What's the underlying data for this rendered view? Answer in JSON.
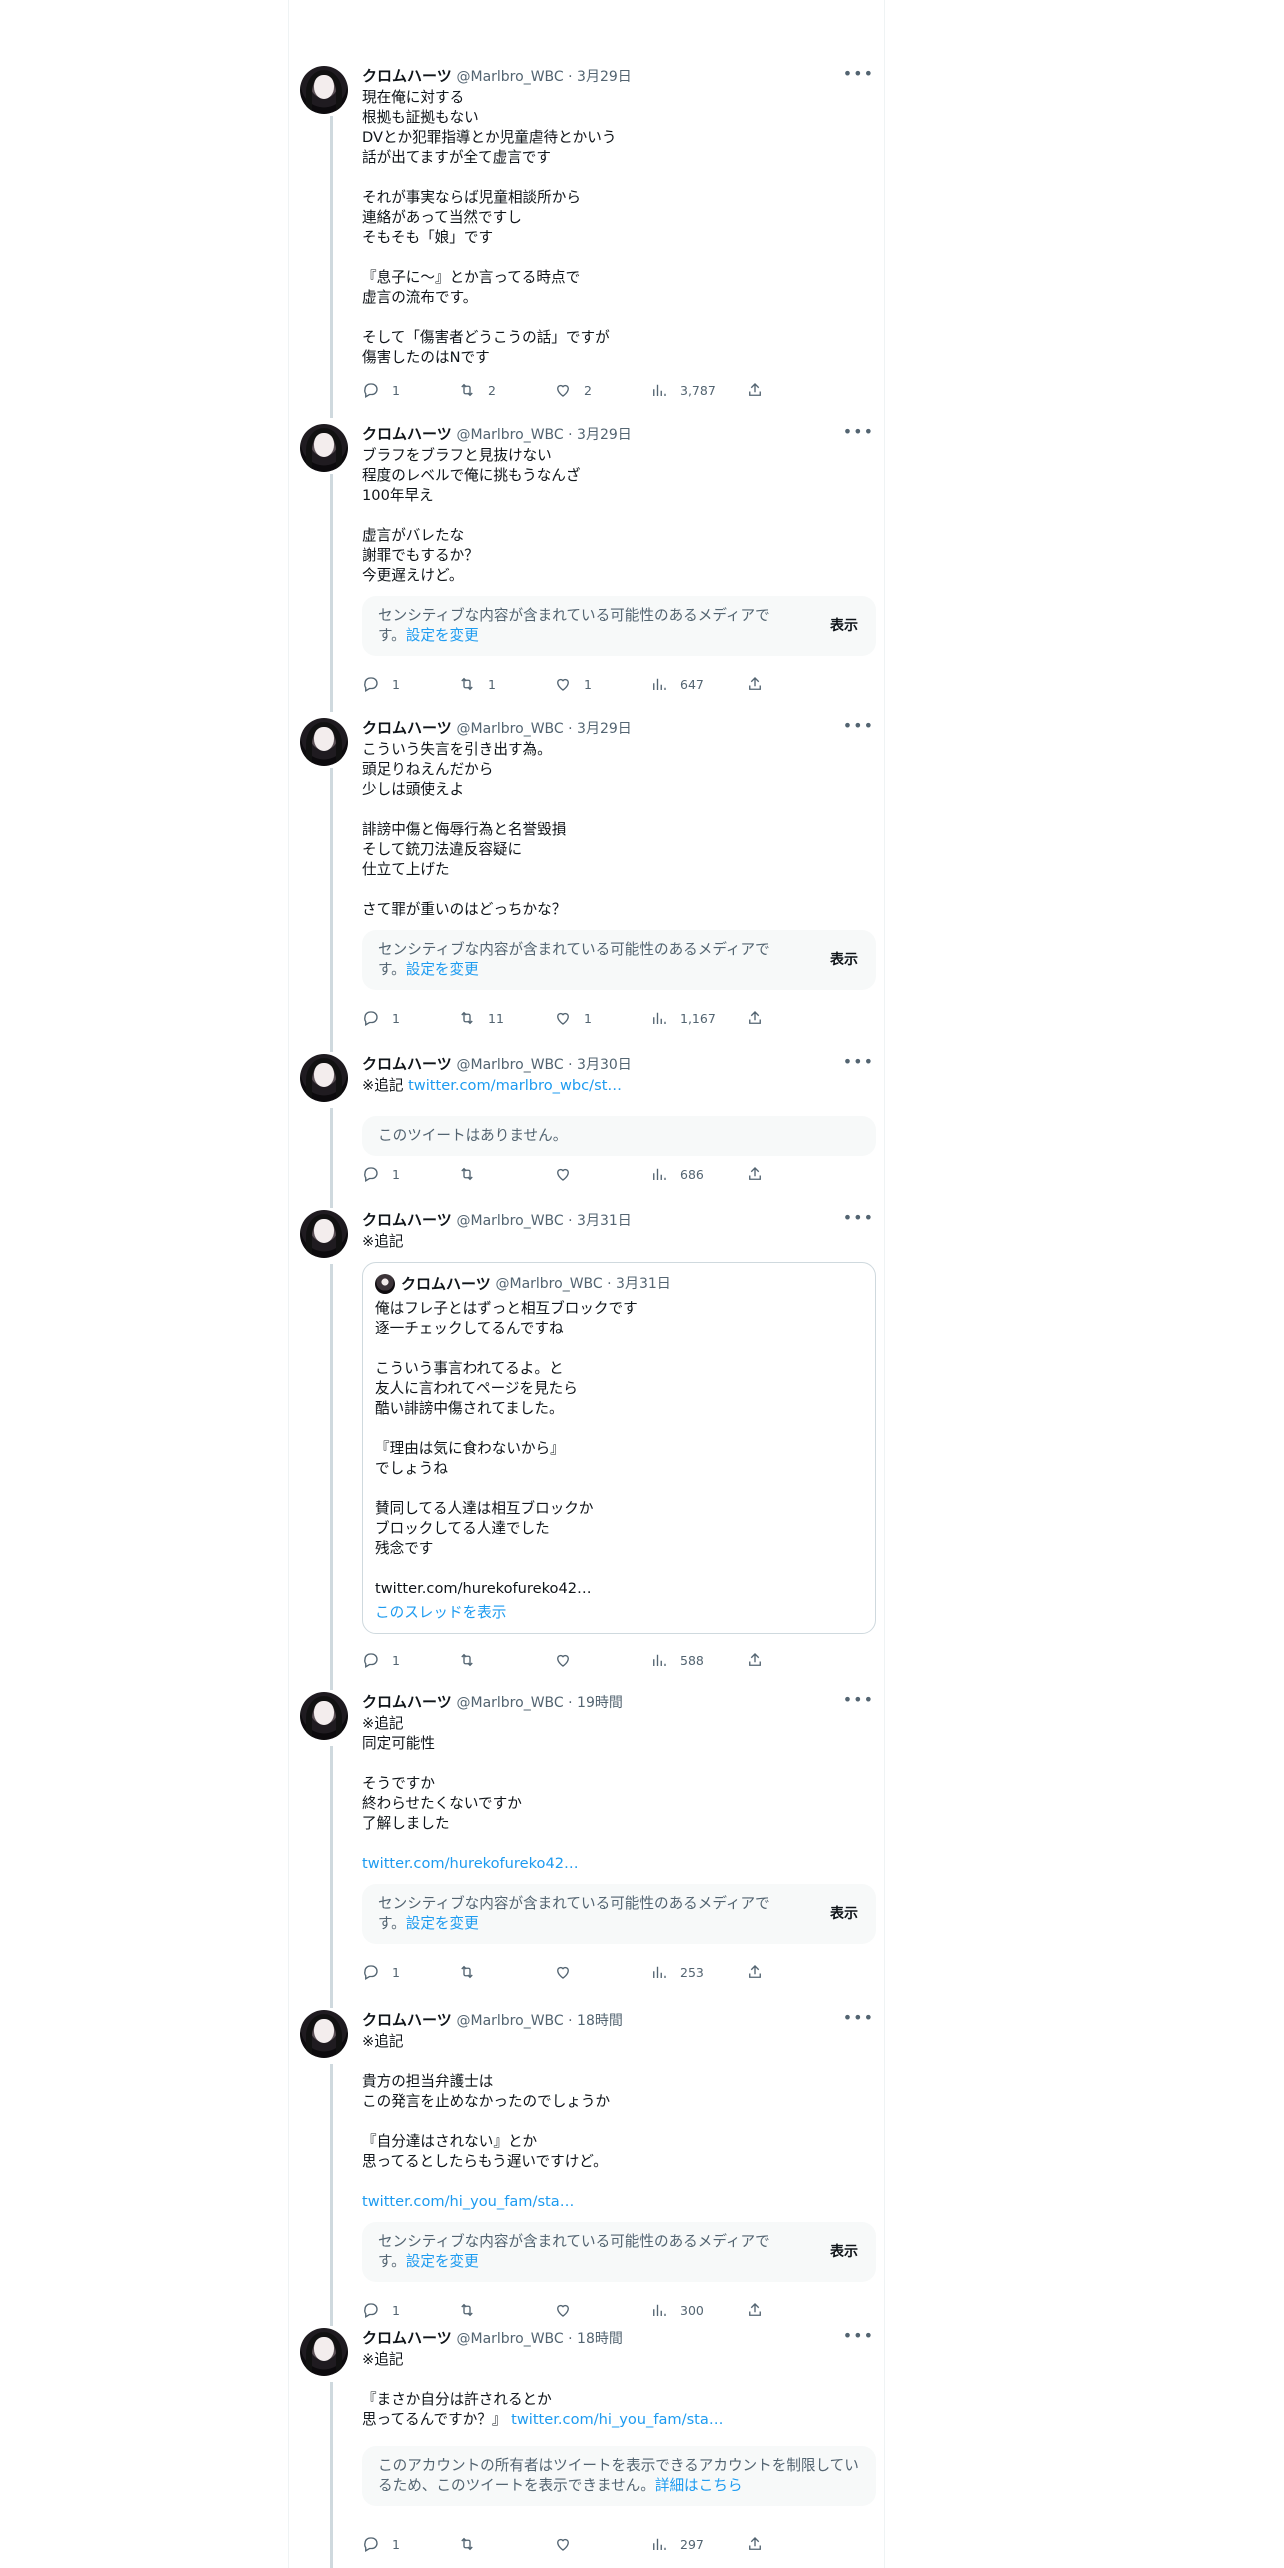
{
  "tweets": [
    {
      "name": "クロムハーツ",
      "handle": "@Marlbro_WBC",
      "time": "3月29日",
      "text": "現在俺に対する\n根拠も証拠もない\nDVとか犯罪指導とか児童虐待とかいう\n話が出てますが全て虚言です\n\nそれが事実ならば児童相談所から\n連絡があって当然ですし\nそもそも「娘」です\n\n『息子に〜』とか言ってる時点で\n虚言の流布です。\n\nそして「傷害者どうこうの話」ですが\n傷害したのはNです",
      "replies": "1",
      "retweets": "2",
      "likes": "2",
      "views": "3,787"
    },
    {
      "name": "クロムハーツ",
      "handle": "@Marlbro_WBC",
      "time": "3月29日",
      "text": "ブラフをブラフと見抜けない\n程度のレベルで俺に挑もうなんざ\n100年早え\n\n虚言がバレたな\n謝罪でもするか？\n今更遅えけど。",
      "sensitive": "センシティブな内容が含まれている可能性のあるメディアです。",
      "sensitive_link": "設定を変更",
      "show": "表示",
      "replies": "1",
      "retweets": "1",
      "likes": "1",
      "views": "647"
    },
    {
      "name": "クロムハーツ",
      "handle": "@Marlbro_WBC",
      "time": "3月29日",
      "text": "こういう失言を引き出す為。\n頭足りねえんだから\n少しは頭使えよ\n\n誹謗中傷と侮辱行為と名誉毀損\nそして銃刀法違反容疑に\n仕立て上げた\n\nさて罪が重いのはどっちかな？",
      "sensitive": "センシティブな内容が含まれている可能性のあるメディアです。",
      "sensitive_link": "設定を変更",
      "show": "表示",
      "replies": "1",
      "retweets": "11",
      "likes": "1",
      "views": "1,167"
    },
    {
      "name": "クロムハーツ",
      "handle": "@Marlbro_WBC",
      "time": "3月30日",
      "text_prefix": "※追記 ",
      "link": "twitter.com/marlbro_wbc/st…",
      "notfound": "このツイートはありません。",
      "replies": "1",
      "retweets": "",
      "likes": "",
      "views": "686"
    },
    {
      "name": "クロムハーツ",
      "handle": "@Marlbro_WBC",
      "time": "3月31日",
      "text": "※追記",
      "quote": {
        "name": "クロムハーツ",
        "handle": "@Marlbro_WBC",
        "time": "3月31日",
        "text": "俺はフレ子とはずっと相互ブロックです\n逐一チェックしてるんですね\n\nこういう事言われてるよ。と\n友人に言われてページを見たら\n酷い誹謗中傷されてました。\n\n『理由は気に食わないから』\nでしょうね\n\n賛同してる人達は相互ブロックか\nブロックしてる人達でした\n残念です\n\ntwitter.com/hurekofureko42…",
        "thread": "このスレッドを表示"
      },
      "replies": "1",
      "retweets": "",
      "likes": "",
      "views": "588"
    },
    {
      "name": "クロムハーツ",
      "handle": "@Marlbro_WBC",
      "time": "19時間",
      "text": "※追記\n同定可能性\n\nそうですか\n終わらせたくないですか\n了解しました",
      "link": "twitter.com/hurekofureko42…",
      "sensitive": "センシティブな内容が含まれている可能性のあるメディアです。",
      "sensitive_link": "設定を変更",
      "show": "表示",
      "replies": "1",
      "retweets": "",
      "likes": "",
      "views": "253"
    },
    {
      "name": "クロムハーツ",
      "handle": "@Marlbro_WBC",
      "time": "18時間",
      "text": "※追記\n\n貴方の担当弁護士は\nこの発言を止めなかったのでしょうか\n\n『自分達はされない』とか\n思ってるとしたらもう遅いですけど。",
      "link": "twitter.com/hi_you_fam/sta…",
      "sensitive": "センシティブな内容が含まれている可能性のあるメディアです。",
      "sensitive_link": "設定を変更",
      "show": "表示",
      "replies": "1",
      "retweets": "",
      "likes": "",
      "views": "300"
    },
    {
      "name": "クロムハーツ",
      "handle": "@Marlbro_WBC",
      "time": "18時間",
      "text": "※追記\n\n『まさか自分は許されるとか\n思ってるんですか？』 ",
      "link": "twitter.com/hi_you_fam/sta…",
      "restricted": "このアカウントの所有者はツイートを表示できるアカウントを制限しているため、このツイートを表示できません。",
      "restricted_link": "詳細はこちら",
      "replies": "1",
      "retweets": "",
      "likes": "",
      "views": "297"
    }
  ]
}
